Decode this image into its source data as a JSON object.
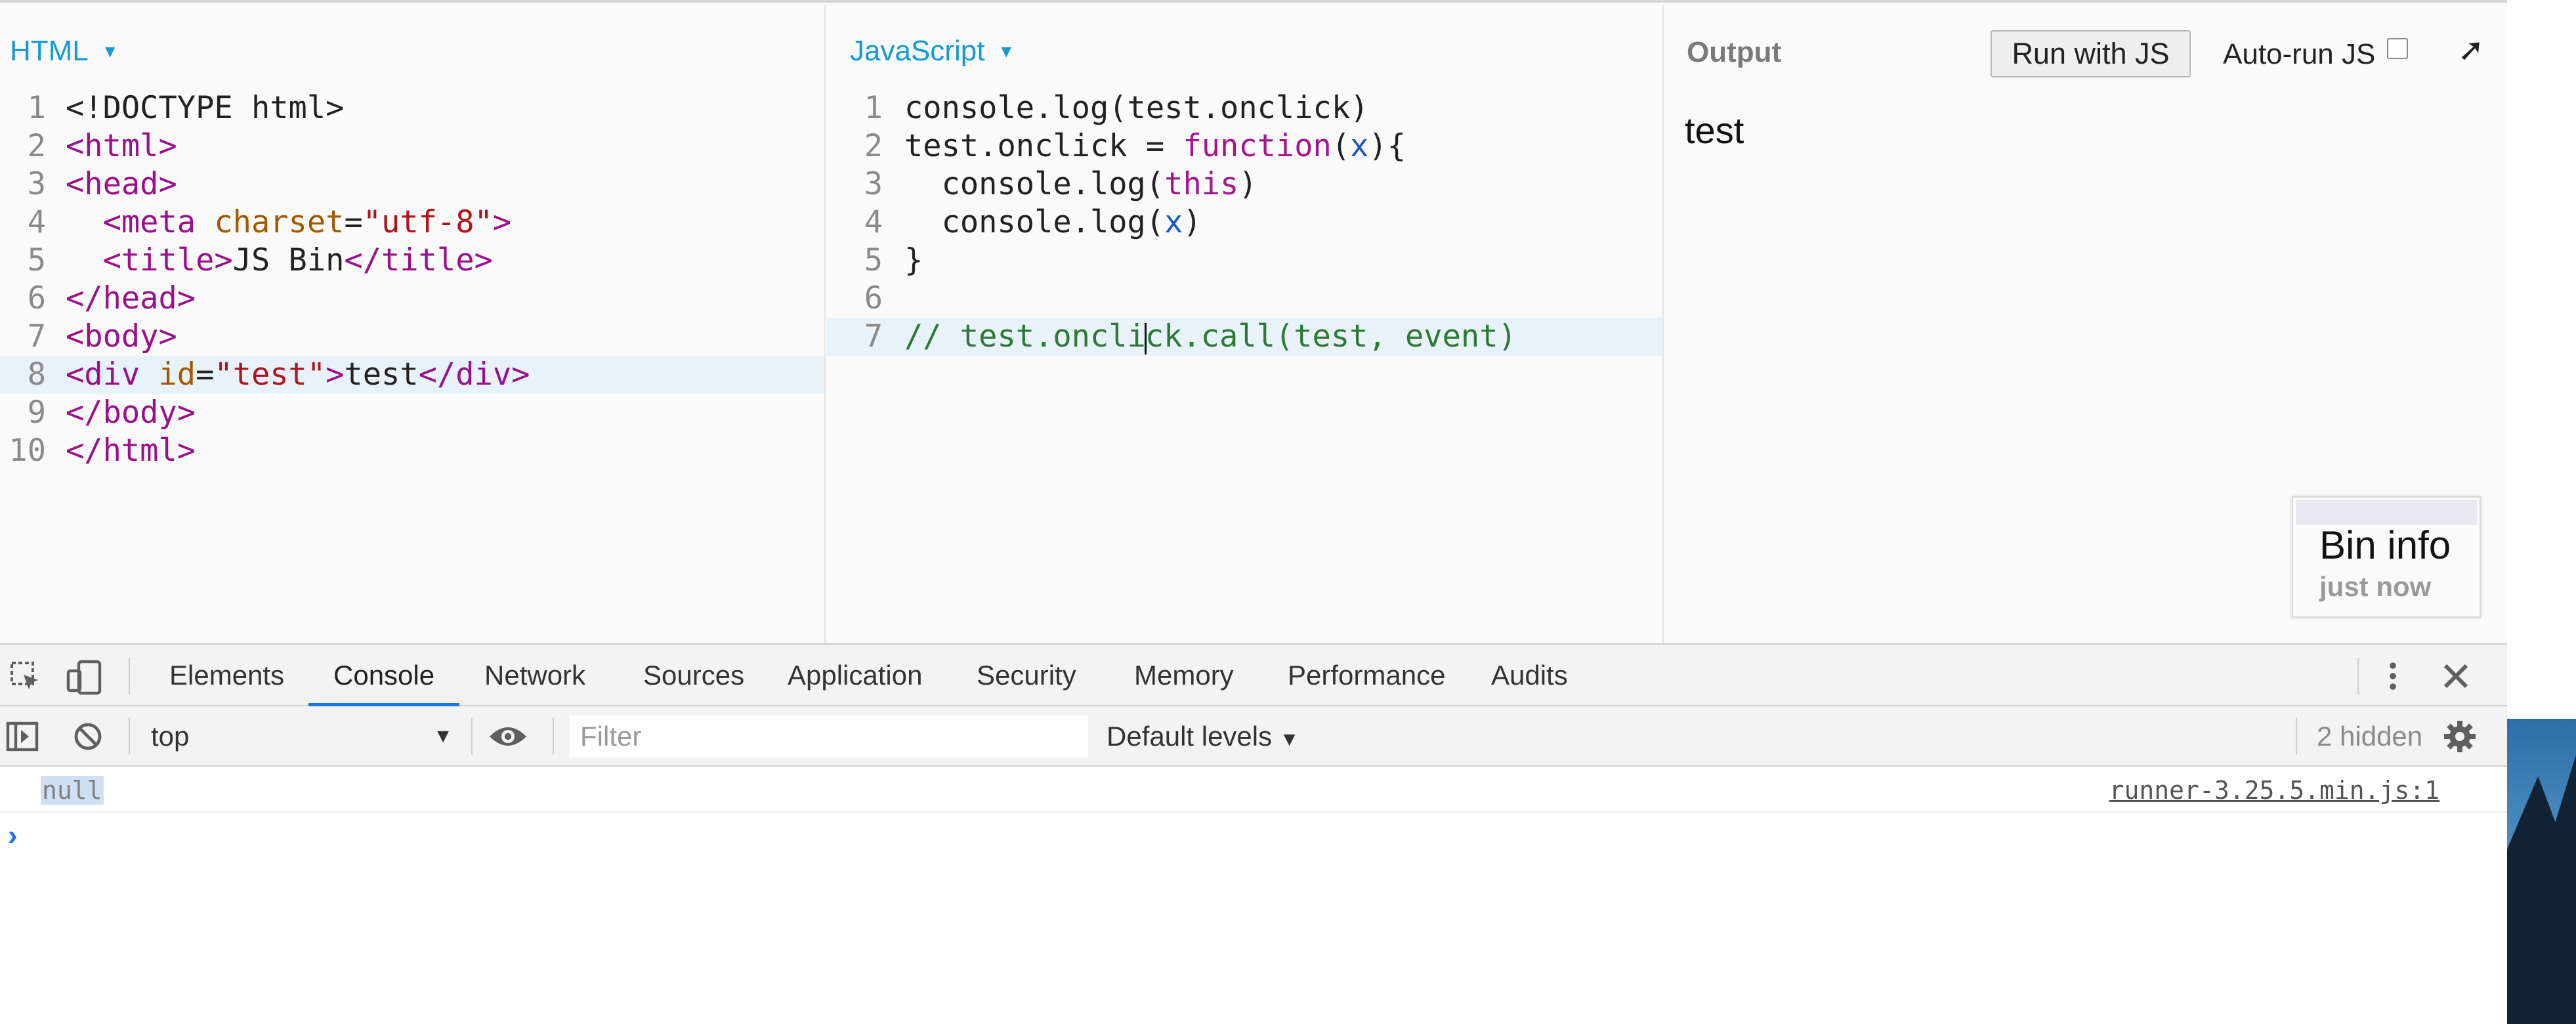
{
  "html_panel": {
    "title": "HTML",
    "lines": [
      {
        "n": "1",
        "parts": [
          {
            "t": "<!DOCTYPE html>",
            "c": "plain"
          }
        ]
      },
      {
        "n": "2",
        "parts": [
          {
            "t": "<html>",
            "c": "tag"
          }
        ]
      },
      {
        "n": "3",
        "parts": [
          {
            "t": "<head>",
            "c": "tag"
          }
        ]
      },
      {
        "n": "4",
        "parts": [
          {
            "t": "  <meta ",
            "c": "tag"
          },
          {
            "t": "charset",
            "c": "attr"
          },
          {
            "t": "=",
            "c": "plain"
          },
          {
            "t": "\"utf-8\"",
            "c": "str"
          },
          {
            "t": ">",
            "c": "tag"
          }
        ]
      },
      {
        "n": "5",
        "parts": [
          {
            "t": "  <title>",
            "c": "tag"
          },
          {
            "t": "JS Bin",
            "c": "plain"
          },
          {
            "t": "</title>",
            "c": "tag"
          }
        ]
      },
      {
        "n": "6",
        "parts": [
          {
            "t": "</head>",
            "c": "tag"
          }
        ]
      },
      {
        "n": "7",
        "parts": [
          {
            "t": "<body>",
            "c": "tag"
          }
        ]
      },
      {
        "n": "8",
        "active": true,
        "parts": [
          {
            "t": "<div ",
            "c": "tag"
          },
          {
            "t": "id",
            "c": "attr"
          },
          {
            "t": "=",
            "c": "plain"
          },
          {
            "t": "\"test\"",
            "c": "str"
          },
          {
            "t": ">",
            "c": "tag"
          },
          {
            "t": "test",
            "c": "plain"
          },
          {
            "t": "</div>",
            "c": "tag"
          }
        ]
      },
      {
        "n": "9",
        "parts": [
          {
            "t": "</body>",
            "c": "tag"
          }
        ]
      },
      {
        "n": "10",
        "parts": [
          {
            "t": "</html>",
            "c": "tag"
          }
        ]
      }
    ]
  },
  "js_panel": {
    "title": "JavaScript",
    "lines": [
      {
        "n": "1",
        "parts": [
          {
            "t": "console.log(test.onclick)",
            "c": "plain"
          }
        ]
      },
      {
        "n": "2",
        "parts": [
          {
            "t": "test.onclick = ",
            "c": "plain"
          },
          {
            "t": "function",
            "c": "kw"
          },
          {
            "t": "(",
            "c": "plain"
          },
          {
            "t": "x",
            "c": "var"
          },
          {
            "t": "){",
            "c": "plain"
          }
        ]
      },
      {
        "n": "3",
        "parts": [
          {
            "t": "  console.log(",
            "c": "plain"
          },
          {
            "t": "this",
            "c": "kw"
          },
          {
            "t": ")",
            "c": "plain"
          }
        ]
      },
      {
        "n": "4",
        "parts": [
          {
            "t": "  console.log(",
            "c": "plain"
          },
          {
            "t": "x",
            "c": "var"
          },
          {
            "t": ")",
            "c": "plain"
          }
        ]
      },
      {
        "n": "5",
        "parts": [
          {
            "t": "}",
            "c": "plain"
          }
        ]
      },
      {
        "n": "6",
        "parts": [
          {
            "t": "",
            "c": "plain"
          }
        ]
      },
      {
        "n": "7",
        "active": true,
        "parts": [
          {
            "t": "// test.oncli",
            "c": "cmt"
          },
          {
            "t": "",
            "c": "cursor"
          },
          {
            "t": "ck.call(test, event)",
            "c": "cmt"
          }
        ]
      }
    ]
  },
  "output_panel": {
    "title": "Output",
    "run_button": "Run with JS",
    "autorun_label": "Auto-run JS",
    "autorun_checked": false,
    "popout_icon": "external-arrow-icon",
    "content_text": "test",
    "bin_info": {
      "title": "Bin info",
      "updated": "just now"
    }
  },
  "devtools": {
    "icons": {
      "inspect": "inspect-element-icon",
      "device": "device-toolbar-icon",
      "more": "kebab-menu-icon",
      "close": "close-icon"
    },
    "tabs": [
      {
        "label": "Elements",
        "active": false
      },
      {
        "label": "Console",
        "active": true
      },
      {
        "label": "Network",
        "active": false
      },
      {
        "label": "Sources",
        "active": false
      },
      {
        "label": "Application",
        "active": false
      },
      {
        "label": "Security",
        "active": false
      },
      {
        "label": "Memory",
        "active": false
      },
      {
        "label": "Performance",
        "active": false
      },
      {
        "label": "Audits",
        "active": false
      }
    ],
    "toolbar": {
      "context": "top",
      "filter_placeholder": "Filter",
      "filter_value": "",
      "levels": "Default levels",
      "hidden": "2 hidden"
    },
    "console": {
      "messages": [
        {
          "text": "null",
          "source": "runner-3.25.5.min.js:1"
        }
      ],
      "prompt": "›"
    }
  },
  "colors": {
    "accent": "#159ad3",
    "tag": "#99108a",
    "attr": "#a05a00",
    "string": "#b1121b",
    "comment": "#2d7a32",
    "active_tab": "#1a73e8"
  }
}
